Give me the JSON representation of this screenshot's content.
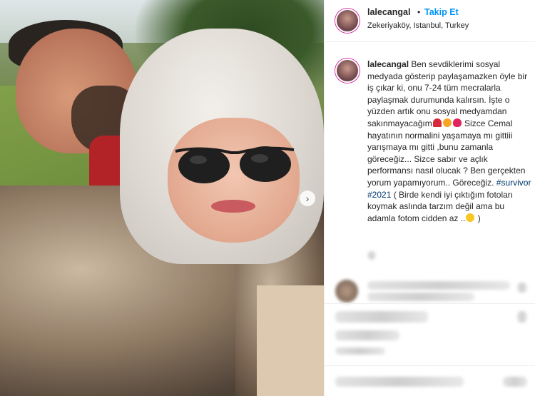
{
  "header": {
    "username": "lalecangal",
    "separator": "•",
    "follow_label": "Takip Et",
    "location": "Zekeriyaköy, Istanbul, Turkey"
  },
  "caption": {
    "username": "lalecangal",
    "lines": [
      "Ben sevdiklerimi sosyal",
      "medyada gösterip paylaşamazken öyle",
      "bir iş çıkar ki, onu 7-24 tüm mecralarla",
      "paylaşmak durumunda kalırsın. İşte o",
      "yüzden artık onu sosyal medyamdan",
      "sakınmayacağım",
      "Sizce Cemal",
      "hayatının normalini yaşamaya mı gittiii",
      "yarışmaya mı gitti ,bunu zamanla",
      "göreceğiz... Sizce sabır ve açlık",
      "performansı nasıl olucak ? Ben",
      "gerçekten yorum yapamıyorum..",
      "Göreceğiz.",
      "#survivor",
      "#2021",
      "( Birde",
      "kendi iyi çıktığım fotoları koymak",
      "aslında tarzım değil ama bu adamla",
      "fotom cidden az ..",
      ")"
    ]
  },
  "icons": {
    "next": "chevron-right-icon",
    "avatar": "profile-avatar"
  },
  "colors": {
    "follow": "#0095f6",
    "hashtag": "#00376b",
    "text": "#262626"
  }
}
